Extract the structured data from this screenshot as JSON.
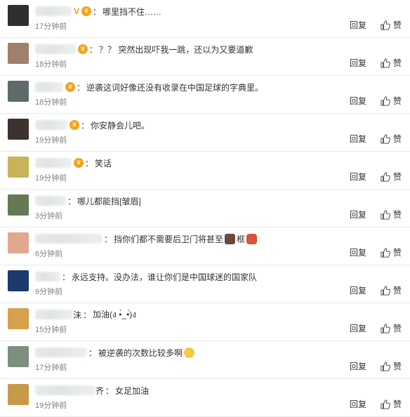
{
  "reply_label": "回复",
  "like_label": "赞",
  "comments": [
    {
      "text": "哪里挡不住……",
      "time": "17分钟前",
      "name_width": 52,
      "avatar": "#2f2f2f",
      "v": true,
      "emoji": ""
    },
    {
      "text": "？？ 突然出现吓我一跳，还以为又要道歉",
      "time": "18分钟前",
      "name_width": 58,
      "avatar": "#a07f6b",
      "v": false,
      "emoji": ""
    },
    {
      "text": "逆袭这词好像还没有收录在中国足球的字典里。",
      "time": "18分钟前",
      "name_width": 40,
      "avatar": "#5d6a6a",
      "v": false,
      "emoji": ""
    },
    {
      "text": "你安静会儿吧。",
      "time": "19分钟前",
      "name_width": 46,
      "avatar": "#3c3330",
      "v": false,
      "emoji": ""
    },
    {
      "text": "笑话",
      "time": "19分钟前",
      "name_width": 52,
      "avatar": "#c9b35a",
      "v": false,
      "emoji": ""
    },
    {
      "text": "哪儿都能挡[皱眉]",
      "time": "3分钟前",
      "name_width": 44,
      "avatar": "#647a55",
      "v": false,
      "emoji": ""
    },
    {
      "text": "挡你们都不需要后卫门将甚至",
      "text2": "框",
      "time": "6分钟前",
      "name_width": 96,
      "avatar": "#e1a88f",
      "v": false,
      "emoji": "goal"
    },
    {
      "text": "永远支持。没办法，谁让你们是中国球迷的国家队",
      "time": "9分钟前",
      "name_width": 36,
      "avatar": "#1b3a6b",
      "v": false,
      "emoji": ""
    },
    {
      "text": "加油(ง •̀_•́)ง",
      "time": "15分钟前",
      "name_width": 54,
      "avatar": "#d6a14c",
      "v": false,
      "emoji": "",
      "suffix": "沬"
    },
    {
      "text": "被逆袭的次数比较多啊",
      "time": "17分钟前",
      "name_width": 74,
      "avatar": "#7b8f7c",
      "v": false,
      "emoji": "smirk"
    },
    {
      "text": "女足加油",
      "time": "19分钟前",
      "name_width": 86,
      "avatar": "#c79a4a",
      "v": false,
      "emoji": "",
      "suffix": "齐"
    }
  ],
  "colors": {
    "vip": "#f7a21b",
    "time": "#808080",
    "divider": "#e9e9e9"
  }
}
